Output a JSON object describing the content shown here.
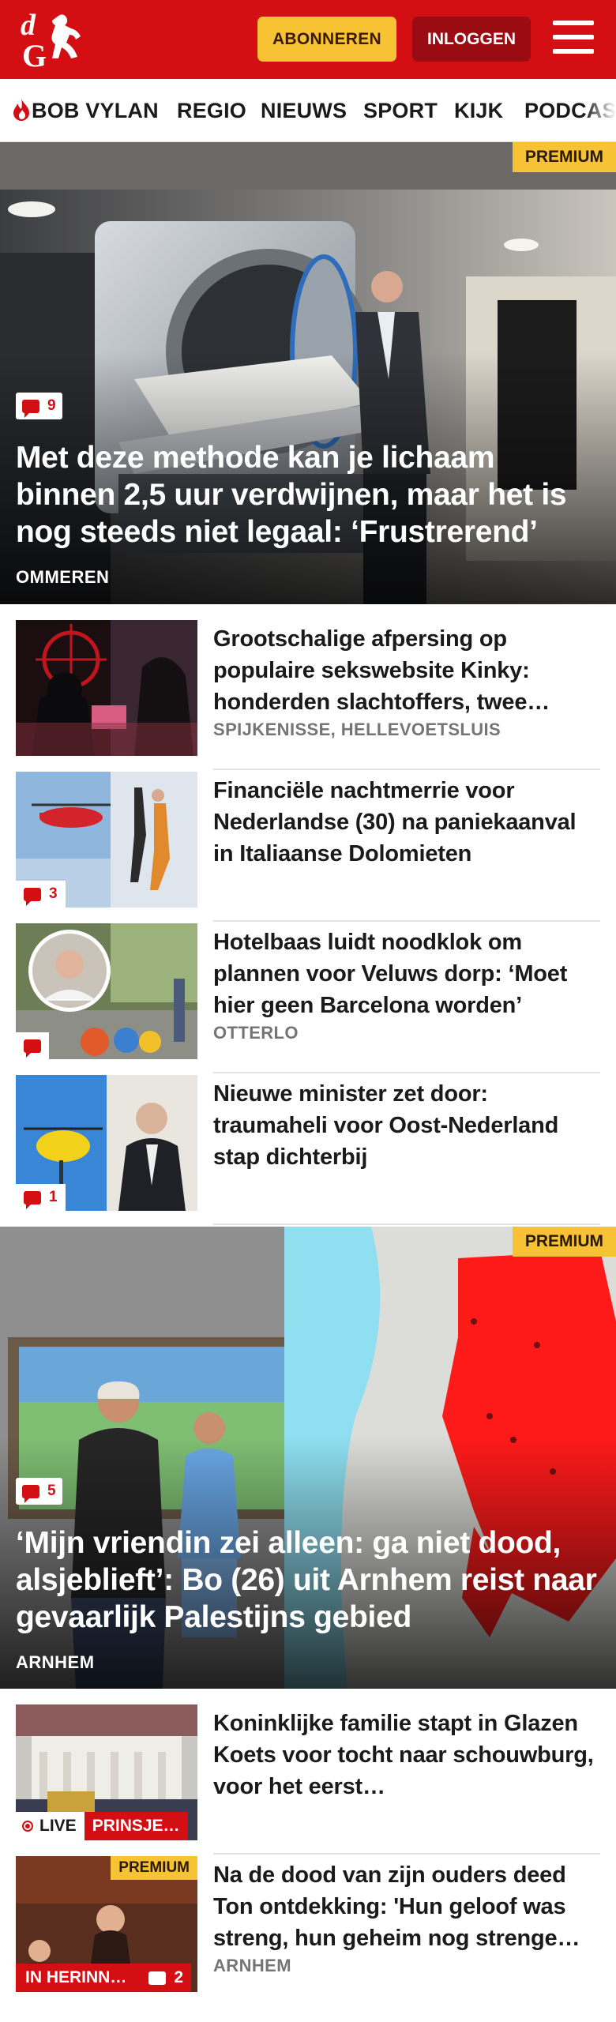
{
  "header": {
    "logo_text": "dG",
    "subscribe_label": "ABONNEREN",
    "login_label": "INLOGGEN"
  },
  "nav": {
    "items": [
      "BOB VYLAN",
      "REGIO",
      "NIEUWS",
      "SPORT",
      "KIJK",
      "PODCAS"
    ]
  },
  "hero1": {
    "premium": "PREMIUM",
    "comments": "9",
    "title": "Met deze methode kan je lichaam binnen 2,5 uur verdwijnen, maar het is nog steeds niet legaal: ‘Frustrerend’",
    "location": "OMMEREN"
  },
  "list1": [
    {
      "title": "Grootschalige afpersing op populaire sekswebsite Kinky: honderden slachtoffers, twee…",
      "location": "SPIJKENISSE, HELLEVOETSLUIS",
      "comments": ""
    },
    {
      "title": "Financiële nachtmerrie voor Nederlandse (30) na paniekaan­val in Italiaanse Dolomieten",
      "location": "",
      "comments": "3"
    },
    {
      "title": "Hotelbaas luidt noodklok om plannen voor Veluws dorp: ‘Moet hier geen Barcelona worden’",
      "location": "OTTERLO",
      "comments": ""
    },
    {
      "title": "Nieuwe minister zet door: traumaheli voor Oost-Nederland stap dichterbij",
      "location": "",
      "comments": "1"
    }
  ],
  "hero2": {
    "premium": "PREMIUM",
    "comments": "5",
    "title": "‘Mijn vriendin zei alleen: ga niet dood, alsjeblieft’: Bo (26) uit Arnhem reist naar gevaarlijk Palestijns gebied",
    "location": "ARNHEM"
  },
  "list2": [
    {
      "title": "Koninklijke familie stapt in Glazen Koets voor tocht naar schouwburg, voor het eerst…",
      "live": "LIVE",
      "tag": "PRINSJE…"
    },
    {
      "title": "Na de dood van zijn ouders deed Ton ontdekking: 'Hun geloof was streng, hun geheim nog strenge…",
      "location": "ARNHEM",
      "premium": "PREMIUM",
      "tag": "IN HERINN…",
      "comments": "2"
    }
  ],
  "colors": {
    "brand_red": "#d40f14",
    "premium_yellow": "#f7c233",
    "login_dark_red": "#9b0c12"
  },
  "icons": [
    "dg-logo",
    "hamburger-menu-icon",
    "flame-icon",
    "comment-bubble-icon",
    "live-dot-icon"
  ]
}
